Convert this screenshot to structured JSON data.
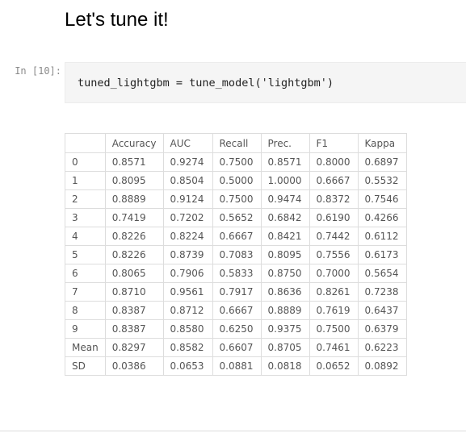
{
  "heading": "Let's tune it!",
  "cell": {
    "prompt": "In [10]:",
    "code": "tuned_lightgbm = tune_model('lightgbm')"
  },
  "table": {
    "columns": [
      "",
      "Accuracy",
      "AUC",
      "Recall",
      "Prec.",
      "F1",
      "Kappa"
    ],
    "rows": [
      [
        "0",
        "0.8571",
        "0.9274",
        "0.7500",
        "0.8571",
        "0.8000",
        "0.6897"
      ],
      [
        "1",
        "0.8095",
        "0.8504",
        "0.5000",
        "1.0000",
        "0.6667",
        "0.5532"
      ],
      [
        "2",
        "0.8889",
        "0.9124",
        "0.7500",
        "0.9474",
        "0.8372",
        "0.7546"
      ],
      [
        "3",
        "0.7419",
        "0.7202",
        "0.5652",
        "0.6842",
        "0.6190",
        "0.4266"
      ],
      [
        "4",
        "0.8226",
        "0.8224",
        "0.6667",
        "0.8421",
        "0.7442",
        "0.6112"
      ],
      [
        "5",
        "0.8226",
        "0.8739",
        "0.7083",
        "0.8095",
        "0.7556",
        "0.6173"
      ],
      [
        "6",
        "0.8065",
        "0.7906",
        "0.5833",
        "0.8750",
        "0.7000",
        "0.5654"
      ],
      [
        "7",
        "0.8710",
        "0.9561",
        "0.7917",
        "0.8636",
        "0.8261",
        "0.7238"
      ],
      [
        "8",
        "0.8387",
        "0.8712",
        "0.6667",
        "0.8889",
        "0.7619",
        "0.6437"
      ],
      [
        "9",
        "0.8387",
        "0.8580",
        "0.6250",
        "0.9375",
        "0.7500",
        "0.6379"
      ],
      [
        "Mean",
        "0.8297",
        "0.8582",
        "0.6607",
        "0.8705",
        "0.7461",
        "0.6223"
      ],
      [
        "SD",
        "0.0386",
        "0.0653",
        "0.0881",
        "0.0818",
        "0.0652",
        "0.0892"
      ]
    ]
  }
}
